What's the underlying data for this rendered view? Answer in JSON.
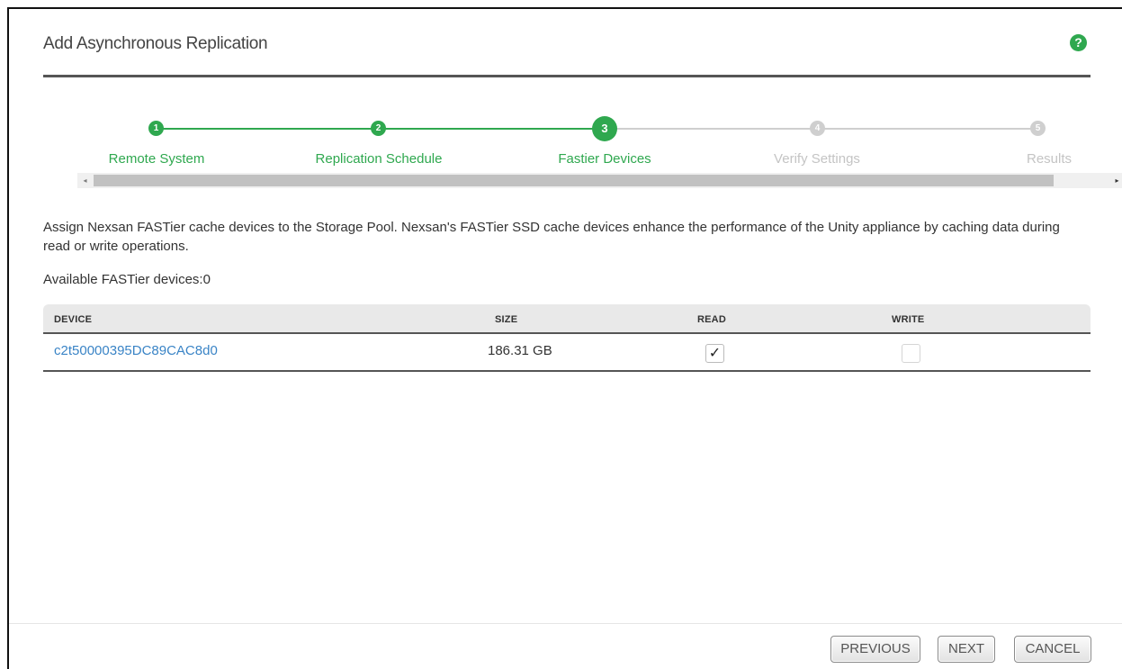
{
  "dialog": {
    "title": "Add Asynchronous Replication",
    "help_icon": "?"
  },
  "wizard": {
    "steps": [
      {
        "number": "1",
        "label": "Remote System",
        "state": "done"
      },
      {
        "number": "2",
        "label": "Replication Schedule",
        "state": "done"
      },
      {
        "number": "3",
        "label": "Fastier Devices",
        "state": "active"
      },
      {
        "number": "4",
        "label": "Verify Settings",
        "state": "todo"
      },
      {
        "number": "5",
        "label": "Results",
        "state": "todo"
      }
    ],
    "scroll_left_icon": "◂",
    "scroll_right_icon": "▸"
  },
  "content": {
    "description": "Assign Nexsan FASTier cache devices to the Storage Pool. Nexsan's FASTier SSD cache devices enhance the performance of the Unity appliance by caching data during read or write operations.",
    "available": "Available FASTier devices:0"
  },
  "table": {
    "columns": [
      "DEVICE",
      "SIZE",
      "READ",
      "WRITE"
    ],
    "rows": [
      {
        "device": "c2t50000395DC89CAC8d0",
        "size": "186.31 GB",
        "read": "✓",
        "write": ""
      }
    ]
  },
  "footer": {
    "previous_label": "PREVIOUS",
    "next_label": "NEXT",
    "cancel_label": "CANCEL"
  },
  "colors": {
    "accent_green": "#2fa84f",
    "inactive_gray": "#cfcfcf",
    "link_blue": "#3a84c6"
  }
}
